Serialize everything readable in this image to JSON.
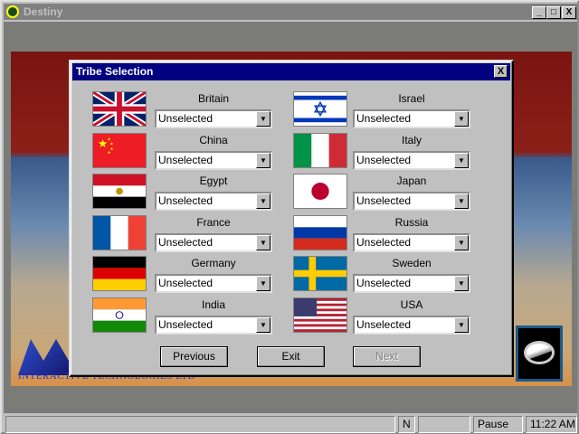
{
  "window": {
    "title": "Destiny",
    "minimize": "_",
    "maximize": "□",
    "close": "X"
  },
  "background": {
    "logo_text": "INTERACTIVE TECHNOLOGIES LTD"
  },
  "dialog": {
    "title": "Tribe Selection",
    "close": "X",
    "tribes": [
      {
        "name": "Britain",
        "value": "Unselected"
      },
      {
        "name": "China",
        "value": "Unselected"
      },
      {
        "name": "Egypt",
        "value": "Unselected"
      },
      {
        "name": "France",
        "value": "Unselected"
      },
      {
        "name": "Germany",
        "value": "Unselected"
      },
      {
        "name": "India",
        "value": "Unselected"
      },
      {
        "name": "Israel",
        "value": "Unselected"
      },
      {
        "name": "Italy",
        "value": "Unselected"
      },
      {
        "name": "Japan",
        "value": "Unselected"
      },
      {
        "name": "Russia",
        "value": "Unselected"
      },
      {
        "name": "Sweden",
        "value": "Unselected"
      },
      {
        "name": "USA",
        "value": "Unselected"
      }
    ],
    "buttons": {
      "previous": "Previous",
      "exit": "Exit",
      "next": "Next"
    }
  },
  "statusbar": {
    "panel1": "",
    "mode": "N",
    "panel3": "",
    "pause": "Pause",
    "time": "11:22 AM"
  }
}
